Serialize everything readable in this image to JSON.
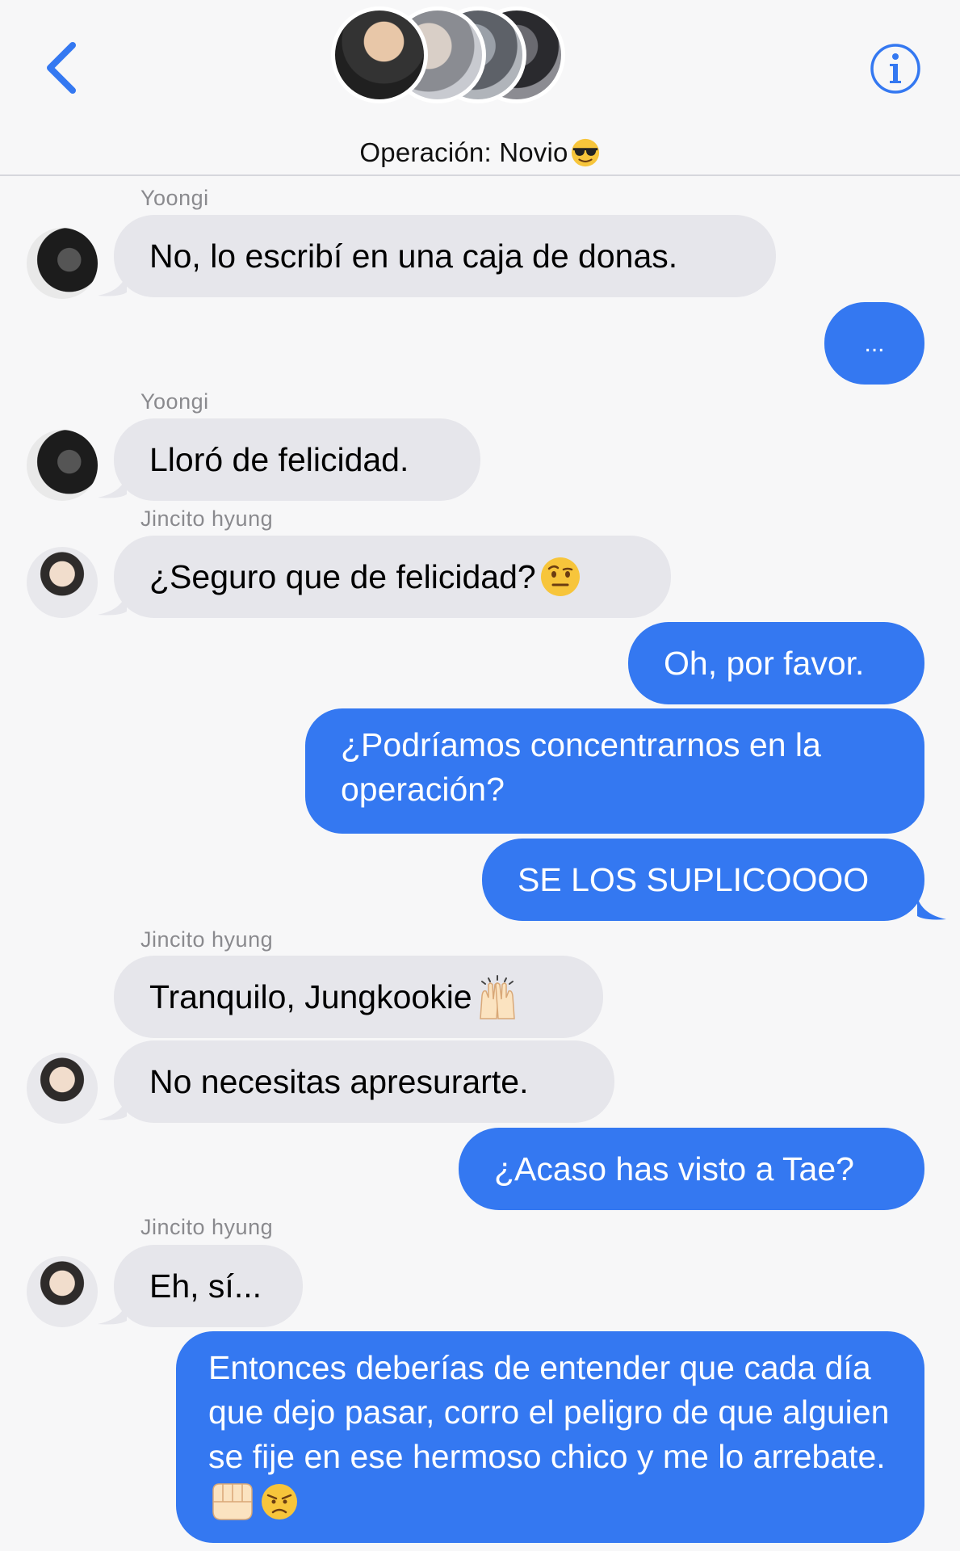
{
  "header": {
    "back_icon": "chevron-left-icon",
    "info_icon": "info-icon",
    "title": "Operación: Novio",
    "title_emoji": "sunglasses-emoji",
    "accent": "#3478f1"
  },
  "messages": [
    {
      "sender": "Yoongi",
      "text": "No, lo escribí en una caja de donas.",
      "from": "them"
    },
    {
      "text": "...",
      "from": "me"
    },
    {
      "sender": "Yoongi",
      "text": "Lloró de felicidad.",
      "from": "them"
    },
    {
      "sender": "Jincito hyung",
      "text": "¿Seguro que de felicidad?",
      "from": "them",
      "emoji": "raised-eyebrow-emoji"
    },
    {
      "text": "Oh, por favor.",
      "from": "me"
    },
    {
      "text": "¿Podríamos concentrarnos en la operación?",
      "from": "me"
    },
    {
      "text": "SE LOS SUPLICOOOO",
      "from": "me"
    },
    {
      "sender": "Jincito hyung",
      "text": "Tranquilo, Jungkookie",
      "from": "them",
      "emoji": "raising-hands-emoji"
    },
    {
      "text": "No necesitas apresurarte.",
      "from": "them"
    },
    {
      "text": "¿Acaso has visto a Tae?",
      "from": "me"
    },
    {
      "sender": "Jincito hyung",
      "text": "Eh, sí...",
      "from": "them"
    },
    {
      "text": "Entonces deberías de entender que cada día que dejo pasar, corro el peligro de que alguien se fije en ese hermoso chico y me lo arrebate.",
      "from": "me",
      "emoji": "fist-and-angry-emoji"
    }
  ],
  "colors": {
    "sent_bubble": "#3478f1",
    "received_bubble": "#e6e6eb",
    "sender_name": "#8a8a8e"
  }
}
